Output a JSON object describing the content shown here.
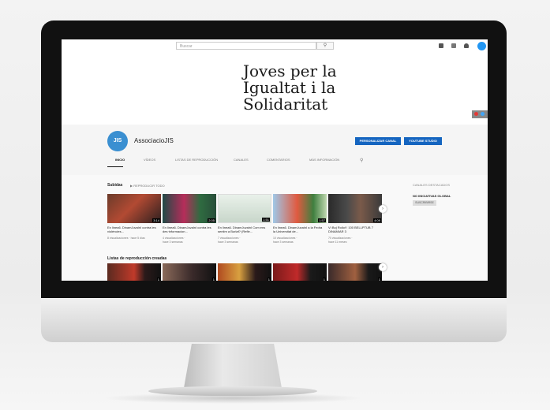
{
  "search": {
    "placeholder": "Buscar"
  },
  "banner": {
    "title_line1": "Joves per la",
    "title_line2": "Igualtat i la",
    "title_line3": "Solidaritat"
  },
  "channel": {
    "name": "AssociacioJIS",
    "avatar_text": "JIS",
    "customize_label": "PERSONALIZAR CANAL",
    "studio_label": "YOUTUBE STUDIO",
    "tabs": [
      "INICIO",
      "VÍDEOS",
      "LISTAS DE REPRODUCCIÓN",
      "CANALES",
      "COMENTARIOS",
      "MÁS INFORMACIÓN"
    ]
  },
  "uploads": {
    "title": "Subidas",
    "play_all": "▶  REPRODUCIR TODO",
    "videos": [
      {
        "title": "En linea6. DinamJuvalnI contra les violències...",
        "meta1": "8 visualizaciones · hace 5 días",
        "duration": "3:14"
      },
      {
        "title": "En linea6. DinamJuvalnI contra les des·informacion...",
        "meta1": "4 visualizaciones ·",
        "meta2": "hace 3 semanas",
        "duration": "2:05"
      },
      {
        "title": "En linea6. DinamJuvalnI Com ens sentim a Burlaf? (Refle...",
        "meta1": "7 visualizaciones ·",
        "meta2": "hace 3 semanas",
        "duration": "1:51"
      },
      {
        "title": "En linea6. DinamJuvalnI a la Fedra la Universitat de...",
        "meta1": "10 visualizaciones ·",
        "meta2": "hace 3 semanas",
        "duration": "1:57"
      },
      {
        "title": "Ví Boj Rollof ! 100 BELLPTUB 7 DINAMIAR 3",
        "meta1": "70 visualizaciones ·",
        "meta2": "hace 11 meses",
        "duration": "4:09"
      }
    ]
  },
  "playlists": {
    "title": "Listas de reproducción creadas",
    "counts": [
      "1",
      "1",
      "1",
      "1",
      "1",
      "14"
    ]
  },
  "sidebar": {
    "title": "CANALES DESTACADOS",
    "item": "NO INICIATIVAS GLOBAL",
    "button": "SUSCRIBIRSE"
  }
}
